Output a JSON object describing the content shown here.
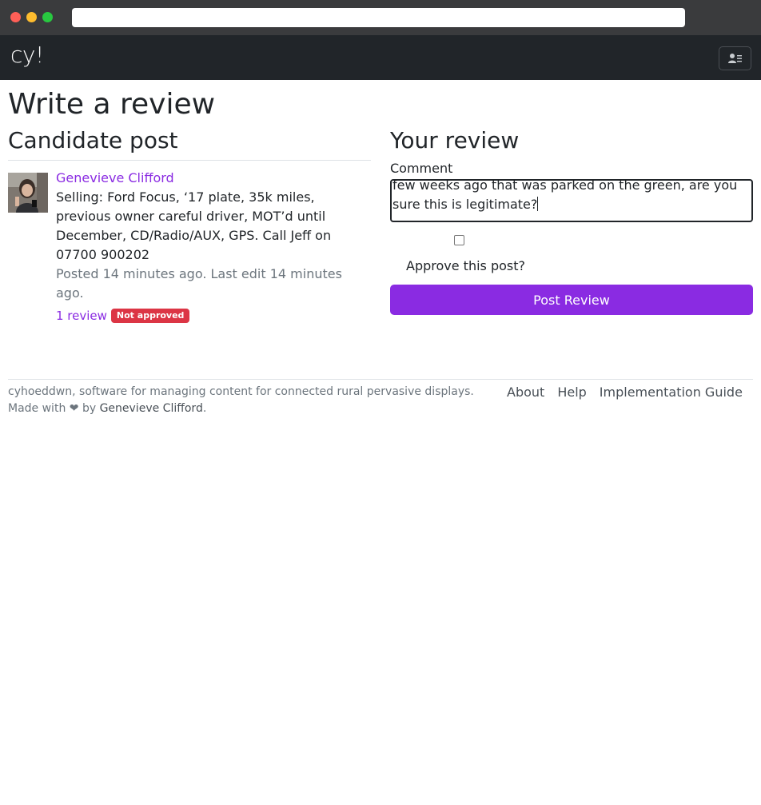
{
  "brand": "cy!",
  "page_title": "Write a review",
  "candidate": {
    "heading": "Candidate post",
    "author": "Genevieve Clifford",
    "body": "Selling: Ford Focus, ‘17 plate, 35k miles, previous owner careful driver, MOT’d until December, CD/Radio/AUX, GPS. Call Jeff on 07700 900202",
    "meta": "Posted 14 minutes ago. Last edit 14 minutes ago.",
    "review_link": "1 review",
    "status_badge": "Not approved"
  },
  "review": {
    "heading": "Your review",
    "comment_label": "Comment",
    "comment_value": "few weeks ago that was parked on the green, are you sure this is legitimate?",
    "approve_label": "Approve this post?",
    "approve_checked": false,
    "submit_label": "Post Review"
  },
  "footer": {
    "description": "cyhoeddwn, software for managing content for connected rural pervasive displays.",
    "made_with": "Made with ❤ by",
    "made_by": "Genevieve Clifford",
    "made_suffix": ".",
    "links": [
      "About",
      "Help",
      "Implementation Guide"
    ]
  },
  "colors": {
    "accent": "#8a2be2",
    "danger": "#dc3545",
    "navbar": "#212529"
  }
}
